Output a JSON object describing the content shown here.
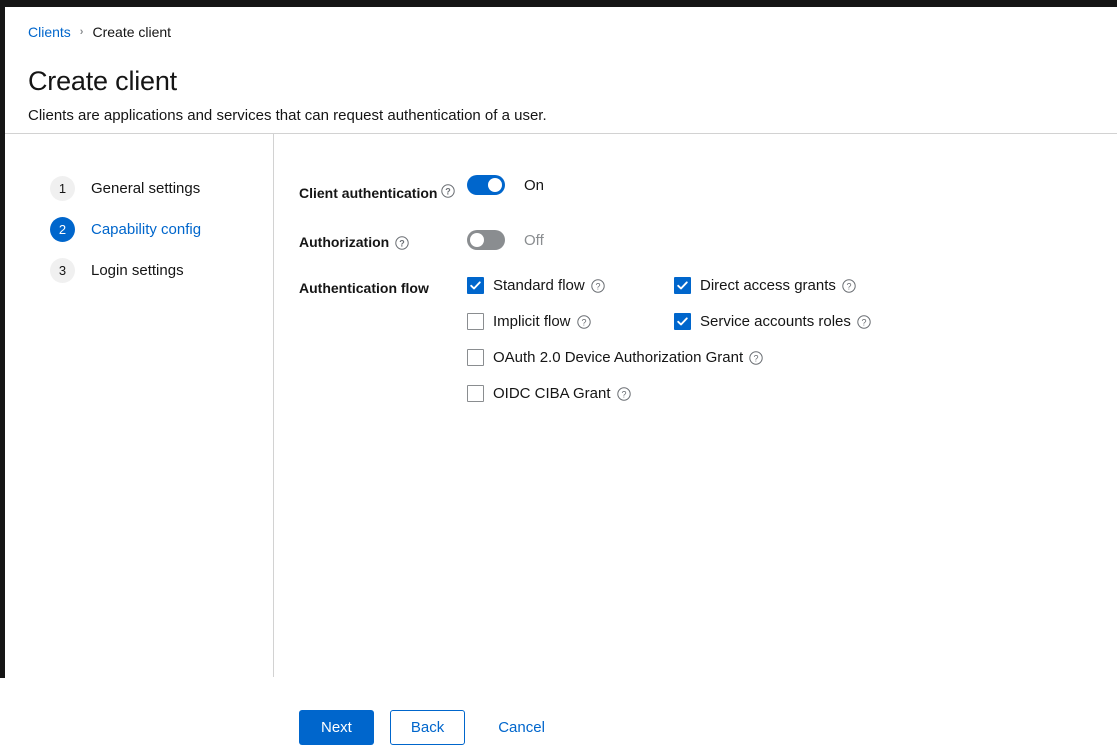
{
  "breadcrumb": {
    "parent": "Clients",
    "separator": "›",
    "current": "Create client"
  },
  "header": {
    "title": "Create client",
    "subtitle": "Clients are applications and services that can request authentication of a user."
  },
  "wizard_nav": {
    "steps": [
      {
        "number": "1",
        "label": "General settings",
        "active": false
      },
      {
        "number": "2",
        "label": "Capability config",
        "active": true
      },
      {
        "number": "3",
        "label": "Login settings",
        "active": false
      }
    ]
  },
  "form": {
    "client_authentication": {
      "label": "Client authentication",
      "help_icon": "help-circle-icon",
      "state": "On",
      "enabled": true
    },
    "authorization": {
      "label": "Authorization",
      "help_icon": "help-circle-icon",
      "state": "Off",
      "enabled": false
    },
    "authentication_flow": {
      "label": "Authentication flow",
      "options": [
        {
          "label": "Standard flow",
          "checked": true,
          "help_icon": "help-circle-icon"
        },
        {
          "label": "Direct access grants",
          "checked": true,
          "help_icon": "help-circle-icon"
        },
        {
          "label": "Implicit flow",
          "checked": false,
          "help_icon": "help-circle-icon"
        },
        {
          "label": "Service accounts roles",
          "checked": true,
          "help_icon": "help-circle-icon"
        },
        {
          "label": "OAuth 2.0 Device Authorization Grant",
          "checked": false,
          "help_icon": "help-circle-icon"
        },
        {
          "label": "OIDC CIBA Grant",
          "checked": false,
          "help_icon": "help-circle-icon"
        }
      ]
    }
  },
  "footer": {
    "next_label": "Next",
    "back_label": "Back",
    "cancel_label": "Cancel"
  },
  "colors": {
    "accent": "#0066cc",
    "toggle_off": "#8a8d90",
    "text": "#151515",
    "border": "#d2d2d2",
    "badge_inactive": "#f0f0f0"
  }
}
